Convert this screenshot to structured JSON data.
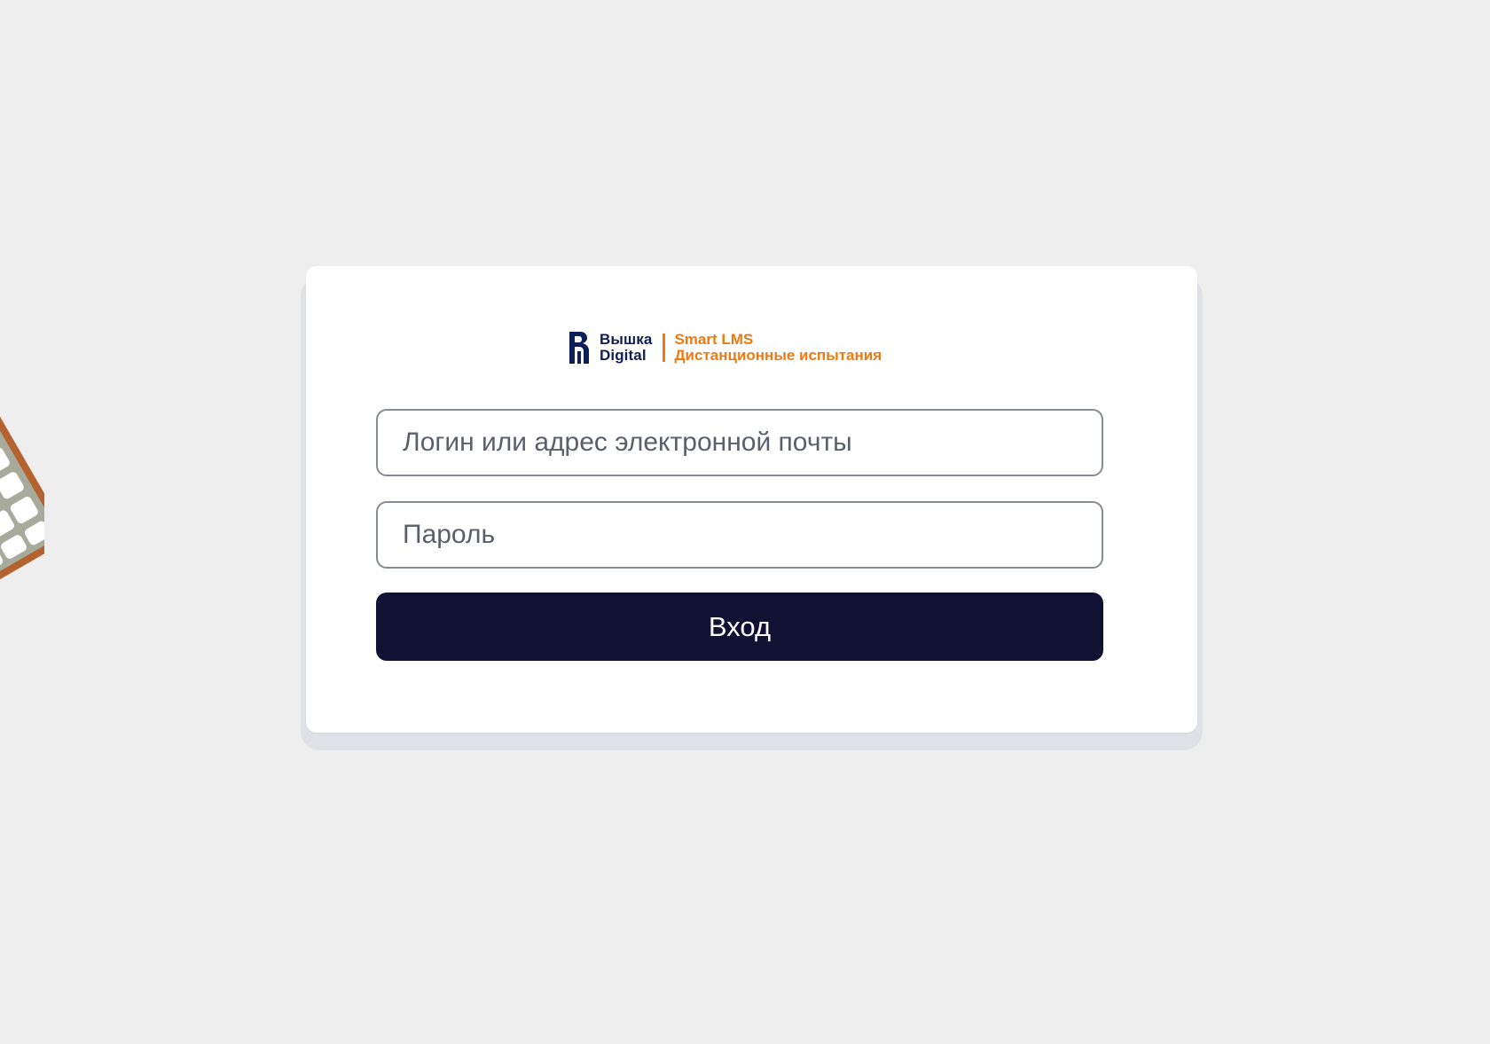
{
  "colors": {
    "page_background": "#eeeeee",
    "card_background": "#ffffff",
    "brand_navy": "#0f1f55",
    "brand_orange": "#f07a10",
    "button_background": "#111133",
    "button_text": "#ffffff",
    "input_border": "#878b93"
  },
  "logo": {
    "icon": "hse-logo-mark",
    "name_line1": "Вышка",
    "name_line2": "Digital",
    "product_line1": "Smart LMS",
    "product_line2": "Дистанционные испытания"
  },
  "form": {
    "login_placeholder": "Логин или адрес электронной почты",
    "login_value": "",
    "password_placeholder": "Пароль",
    "password_value": "",
    "submit_label": "Вход"
  },
  "decoration": {
    "icon": "calculator-illustration"
  }
}
